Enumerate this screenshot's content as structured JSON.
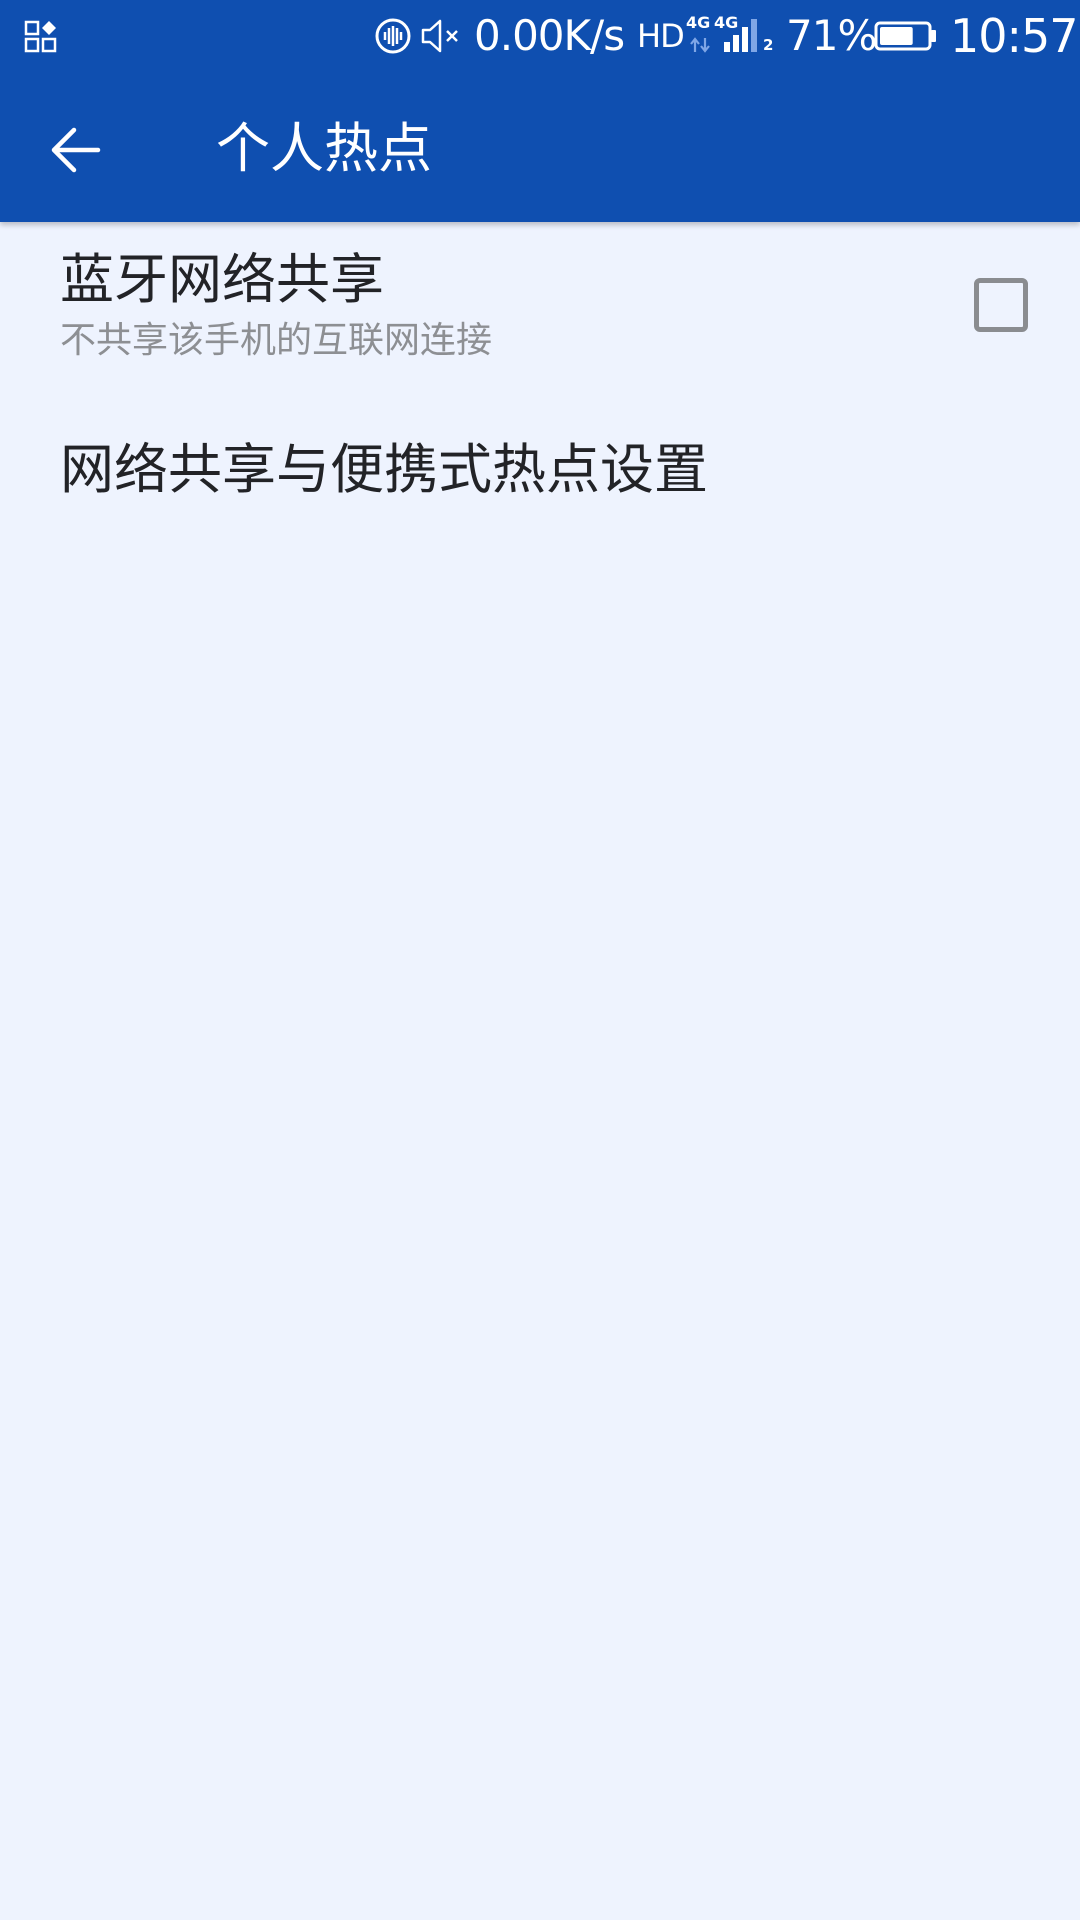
{
  "status_bar": {
    "net_speed": "0.00K/s",
    "hd_label": "HD",
    "net_type_1": "4G",
    "net_type_2": "4G",
    "sim_slot": "2",
    "battery_percent": "71%",
    "battery_level": 0.71,
    "time": "10:57",
    "icons": [
      "apps-icon",
      "voice-icon",
      "mute-icon",
      "data-arrows-icon",
      "signal-icon",
      "battery-icon"
    ]
  },
  "toolbar": {
    "title": "个人热点",
    "back_icon": "back-arrow-icon"
  },
  "preferences": {
    "bluetooth_tethering": {
      "title": "蓝牙网络共享",
      "summary": "不共享该手机的互联网连接",
      "checked": false
    },
    "hotspot_settings": {
      "title": "网络共享与便携式热点设置"
    }
  },
  "colors": {
    "primary": "#0f4fb0",
    "background": "#eef3fe",
    "title_text": "#222327",
    "summary_text": "#8d8f93",
    "checkbox_border": "#8a8c90"
  }
}
